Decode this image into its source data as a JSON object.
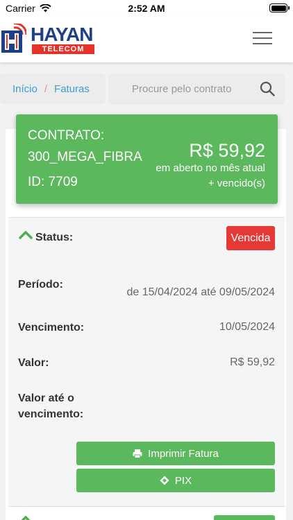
{
  "status_bar": {
    "carrier": "Carrier",
    "time": "2:52 AM"
  },
  "brand": {
    "name": "HAYAN",
    "tagline": "TELECOM",
    "color_primary": "#1d3f8c",
    "color_accent": "#e6332a"
  },
  "header": {
    "menu_icon": "hamburger-icon"
  },
  "breadcrumb": {
    "items": [
      "Início",
      "Faturas"
    ],
    "separator": "/"
  },
  "search": {
    "placeholder": "Procure pelo contrato",
    "icon": "search-icon"
  },
  "contract": {
    "label": "CONTRATO:",
    "name": "300_MEGA_FIBRA",
    "id": "ID: 7709",
    "amount": "R$ 59,92",
    "amount_description": "em aberto no mês atual + vencido(s)",
    "color": "#5cb85c"
  },
  "invoice": {
    "status_label": "Status:",
    "status_value": "Vencida",
    "status_color": "#e53935",
    "period_label": "Período:",
    "period_value": "de 15/04/2024 até 09/05/2024",
    "due_label": "Vencimento:",
    "due_value": "10/05/2024",
    "value_label": "Valor:",
    "value_value": "R$ 59,92",
    "value_until_due_label": "Valor até o vencimento:",
    "print_button": "Imprimir Fatura",
    "pix_button": "PIX"
  }
}
